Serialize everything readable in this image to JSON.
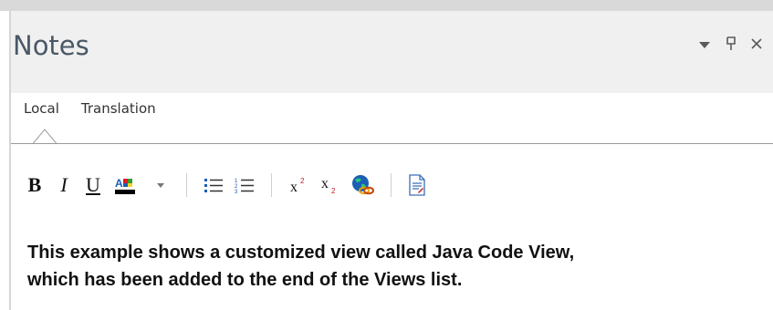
{
  "panel": {
    "title": "Notes",
    "controls": {
      "dropdown_icon": "▼",
      "pin_icon": "ᵖ",
      "close_icon": "×"
    }
  },
  "tabs": [
    {
      "label": "Local",
      "active": true
    },
    {
      "label": "Translation",
      "active": false
    }
  ],
  "toolbar": {
    "bold": "B",
    "italic": "I",
    "underline": "U",
    "superscript": "x",
    "subscript": "x"
  },
  "notes": {
    "line1": "This example shows a customized view called Java Code View,",
    "line2": "which has been added to the end of the Views list."
  },
  "colors": {
    "title_bar": "#f0f0f0",
    "title_text": "#4a5866",
    "divider": "#9a9a9a"
  }
}
